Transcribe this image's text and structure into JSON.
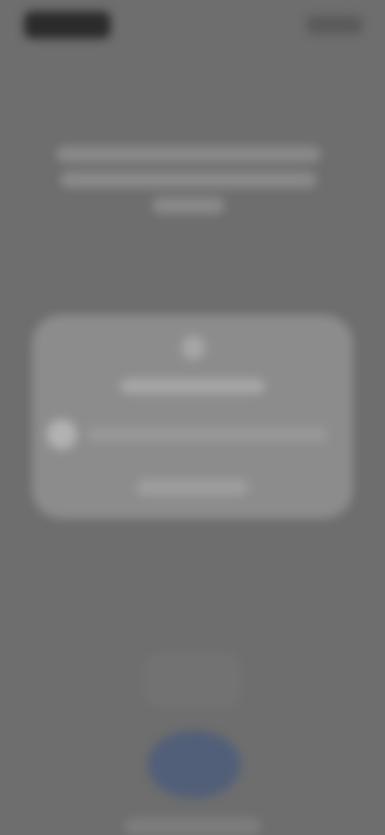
{
  "status_bar": {
    "time": "",
    "icons": [
      "signal-icon",
      "battery-icon"
    ]
  },
  "header": {
    "title": ""
  },
  "card": {
    "icon": "shield-icon",
    "title": "",
    "row_text": "",
    "button_label": ""
  },
  "bottom": {
    "primary_button_icon": "fingerprint-icon"
  },
  "colors": {
    "background": "#6e6e6e",
    "card": "#8c8c8c",
    "accent": "#515f78"
  }
}
